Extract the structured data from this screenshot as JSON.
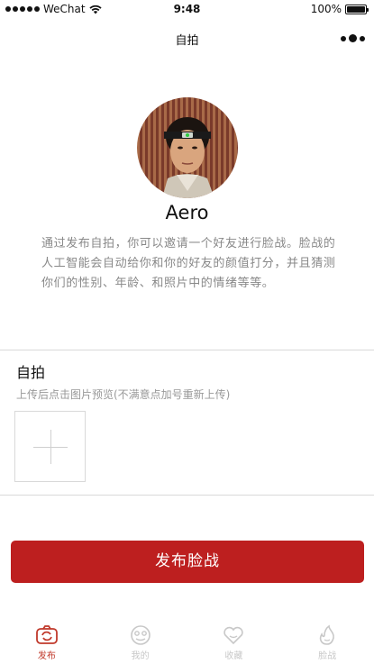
{
  "status_bar": {
    "carrier": "WeChat",
    "time": "9:48",
    "battery": "100%",
    "battery_level": 1.0,
    "signal_bars": 5
  },
  "nav": {
    "title": "自拍"
  },
  "profile": {
    "name": "Aero",
    "intro": "通过发布自拍，你可以邀请一个好友进行脸战。脸战的人工智能会自动给你和你的好友的颜值打分，并且猜测你们的性别、年龄、和照片中的情绪等等。"
  },
  "upload_section": {
    "title": "自拍",
    "hint": "上传后点击图片预览(不满意点加号重新上传)"
  },
  "publish_button": {
    "label": "发布脸战"
  },
  "tabs": [
    {
      "label": "发布",
      "icon": "camera-icon",
      "active": true
    },
    {
      "label": "我的",
      "icon": "face-icon",
      "active": false
    },
    {
      "label": "收藏",
      "icon": "heart-icon",
      "active": false
    },
    {
      "label": "脸战",
      "icon": "flame-icon",
      "active": false
    }
  ],
  "colors": {
    "accent": "#bd1f1f",
    "tab_active": "#c0392b",
    "tab_inactive": "#c8c8c8"
  }
}
